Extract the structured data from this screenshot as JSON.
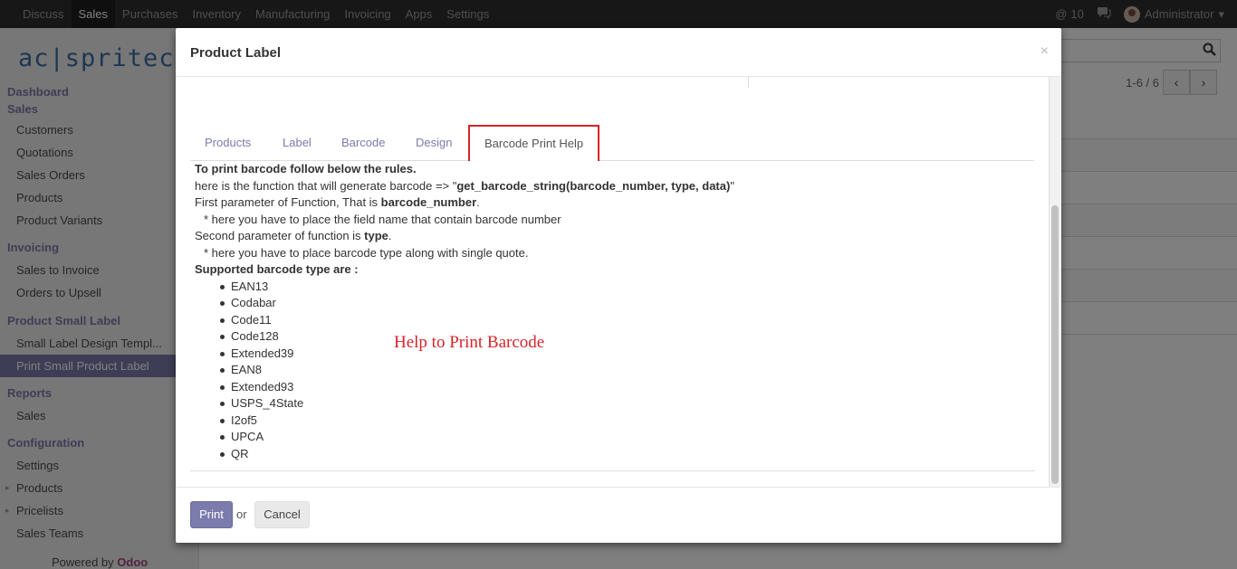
{
  "topbar": {
    "menu": [
      "Discuss",
      "Sales",
      "Purchases",
      "Inventory",
      "Manufacturing",
      "Invoicing",
      "Apps",
      "Settings"
    ],
    "active": "Sales",
    "notifications": "10",
    "user": "Administrator"
  },
  "sidebar": {
    "logo_text": "ac|spritech",
    "sections": [
      {
        "title": "Dashboard",
        "items": []
      },
      {
        "title": "Sales",
        "items": [
          "Customers",
          "Quotations",
          "Sales Orders",
          "Products",
          "Product Variants"
        ]
      },
      {
        "title": "Invoicing",
        "items": [
          "Sales to Invoice",
          "Orders to Upsell"
        ]
      },
      {
        "title": "Product Small Label",
        "items": [
          "Small Label Design Templ...",
          "Print Small Product Label"
        ]
      },
      {
        "title": "Reports",
        "items": [
          "Sales"
        ]
      },
      {
        "title": "Configuration",
        "items": [
          "Settings",
          "Products",
          "Pricelists",
          "Sales Teams"
        ]
      }
    ],
    "active_item": "Print Small Product Label",
    "powered_by": "Powered by",
    "powered_brand": "Odoo"
  },
  "background": {
    "pager": "1-6 / 6",
    "prev_icon": "‹",
    "next_icon": "›"
  },
  "modal": {
    "title": "Product Label",
    "close": "×",
    "tabs": [
      "Products",
      "Label",
      "Barcode",
      "Design",
      "Barcode Print Help"
    ],
    "active_tab": "Barcode Print Help",
    "help": {
      "heading": "To print barcode follow below the rules.",
      "fn_prefix": "here is the function that will generate barcode => \"",
      "fn_name": "get_barcode_string(barcode_number, type, data)",
      "fn_suffix": "\"",
      "p1_prefix": "First parameter of Function, That is ",
      "p1_name": "barcode_number",
      "p1_suffix": ".",
      "p1_note": "* here you have to place the field name that contain barcode number",
      "p2_prefix": "Second parameter of function is ",
      "p2_name": "type",
      "p2_suffix": ".",
      "p2_note": "* here you have to place barcode type along with single quote.",
      "supported_heading": "Supported barcode type are :",
      "types": [
        "EAN13",
        "Codabar",
        "Code11",
        "Code128",
        "Extended39",
        "EAN8",
        "Extended93",
        "USPS_4State",
        "I2of5",
        "UPCA",
        "QR"
      ]
    },
    "annotation": "Help to Print Barcode",
    "footer": {
      "print": "Print",
      "or": "or",
      "cancel": "Cancel"
    }
  }
}
